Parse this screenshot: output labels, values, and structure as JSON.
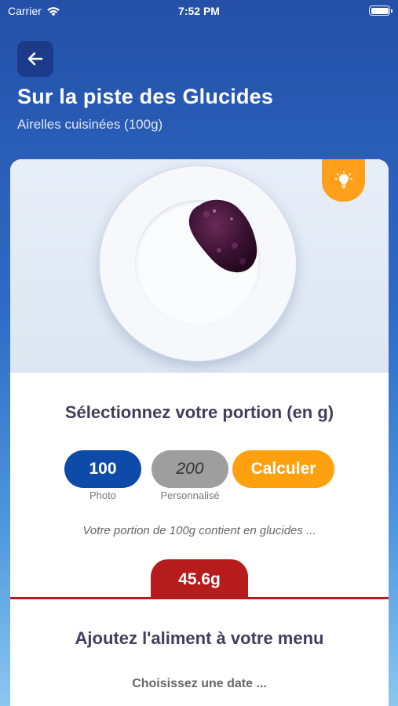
{
  "status_bar": {
    "carrier": "Carrier",
    "time": "7:52 PM"
  },
  "header": {
    "title": "Sur la piste des Glucides",
    "subtitle": "Airelles cuisinées (100g)"
  },
  "portion": {
    "title": "Sélectionnez votre portion (en g)",
    "photo_value": "100",
    "photo_caption": "Photo",
    "custom_placeholder": "200",
    "custom_caption": "Personnalisé",
    "calculate_label": "Calculer",
    "info_text": "Votre portion de 100g contient en glucides ...",
    "result": "45.6g"
  },
  "menu": {
    "title": "Ajoutez l'aliment à votre menu",
    "date_prompt": "Choisissez une date ..."
  },
  "colors": {
    "primary_blue": "#0e4aa8",
    "accent_orange": "#ffa10f",
    "result_red": "#b71c1c"
  },
  "icons": {
    "back": "arrow-left-icon",
    "tip": "lightbulb-icon",
    "wifi": "wifi-icon",
    "battery": "battery-icon"
  }
}
